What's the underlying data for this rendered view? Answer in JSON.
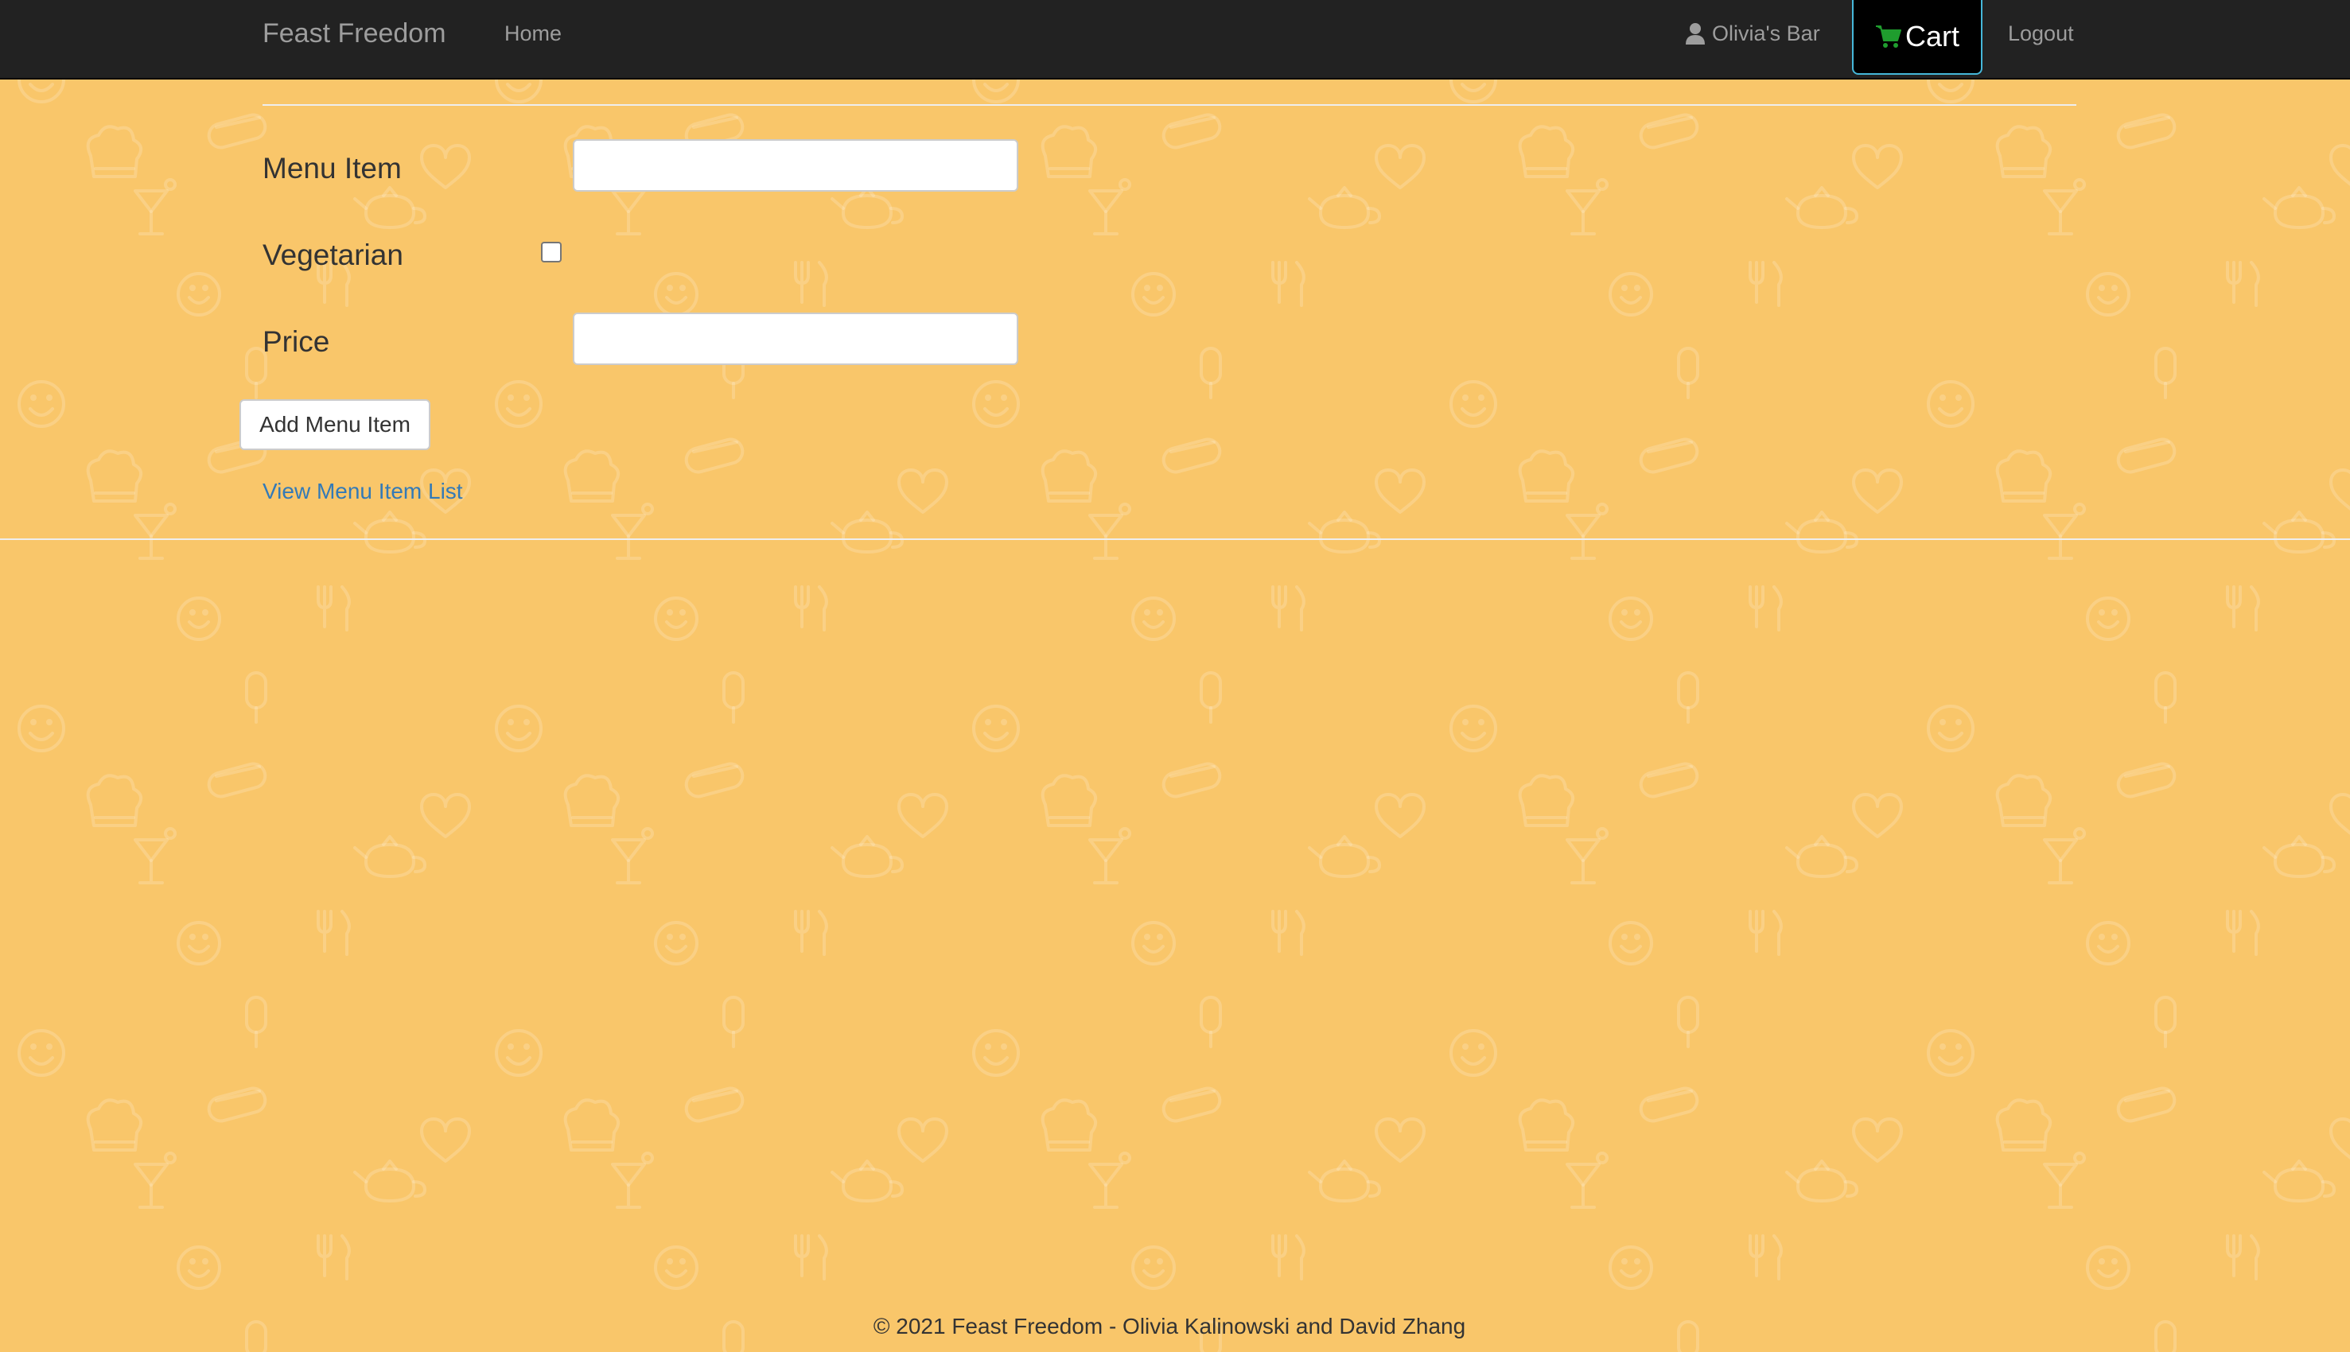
{
  "nav": {
    "brand": "Feast Freedom",
    "home": "Home",
    "user": "Olivia's Bar",
    "cart": "Cart",
    "logout": "Logout"
  },
  "icons": {
    "user": "user-icon",
    "cart": "cart-icon",
    "pattern": [
      "smiley-icon",
      "cocktail-icon",
      "teapot-icon",
      "hotdog-icon",
      "heart-icon",
      "chef-hat-icon",
      "fork-knife-icon",
      "popsicle-icon"
    ]
  },
  "form": {
    "menu_item_label": "Menu Item",
    "menu_item_value": "",
    "vegetarian_label": "Vegetarian",
    "vegetarian_checked": false,
    "price_label": "Price",
    "price_value": "",
    "add_button": "Add Menu Item",
    "view_link": "View Menu Item List"
  },
  "footer": {
    "copyright": "© 2021 Feast Freedom - Olivia Kalinowski and David Zhang"
  },
  "colors": {
    "background": "#f9c66a",
    "navbar": "#222222",
    "cart_accent": "#46b8da",
    "cart_icon": "#1f9d2e",
    "link": "#337ab7"
  }
}
